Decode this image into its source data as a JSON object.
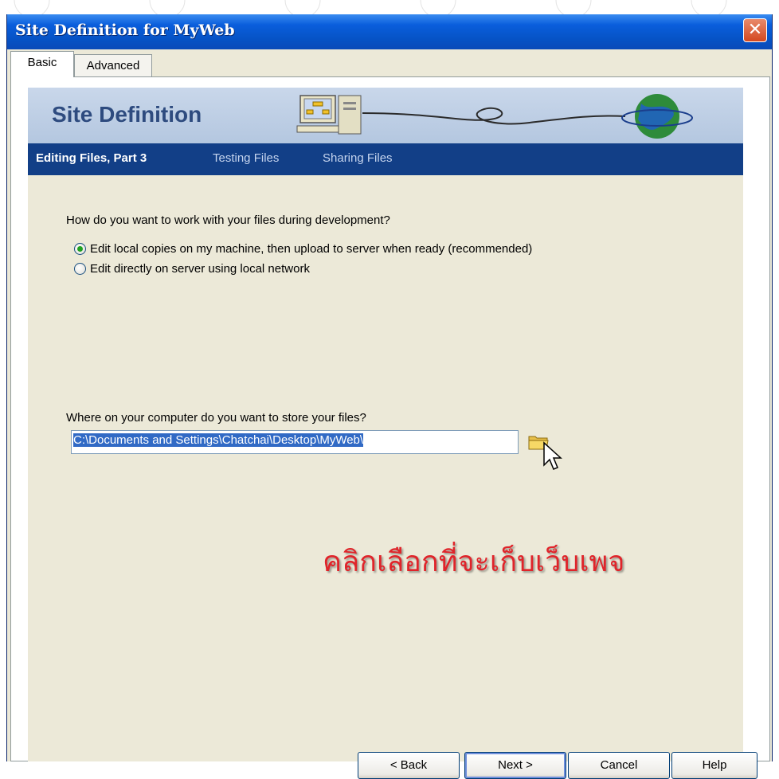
{
  "window": {
    "title": "Site Definition for MyWeb",
    "close_glyph": "✕"
  },
  "tabs": [
    {
      "label": "Basic",
      "active": true
    },
    {
      "label": "Advanced",
      "active": false
    }
  ],
  "banner": {
    "title": "Site Definition",
    "art_icons": [
      "computer-icon",
      "globe-icon"
    ]
  },
  "steps": [
    {
      "label": "Editing Files, Part 3",
      "active": true
    },
    {
      "label": "Testing Files",
      "active": false
    },
    {
      "label": "Sharing Files",
      "active": false
    }
  ],
  "question1": "How do you want to work with your files during development?",
  "options": [
    {
      "label": "Edit local copies on my machine, then upload to server when ready (recommended)",
      "checked": true
    },
    {
      "label": "Edit directly on server using local network",
      "checked": false
    }
  ],
  "question2": "Where on your computer do you want to store your files?",
  "path_value": "C:\\Documents and Settings\\Chatchai\\Desktop\\MyWeb\\",
  "annotation": "คลิกเลือกที่จะเก็บเว็บเพจ",
  "buttons": {
    "back": "< Back",
    "next": "Next >",
    "cancel": "Cancel",
    "help": "Help"
  },
  "colors": {
    "title_bar": "#0A5EDC",
    "step_bar": "#123F87",
    "annotation": "#E0242A",
    "selection": "#316AC5"
  }
}
